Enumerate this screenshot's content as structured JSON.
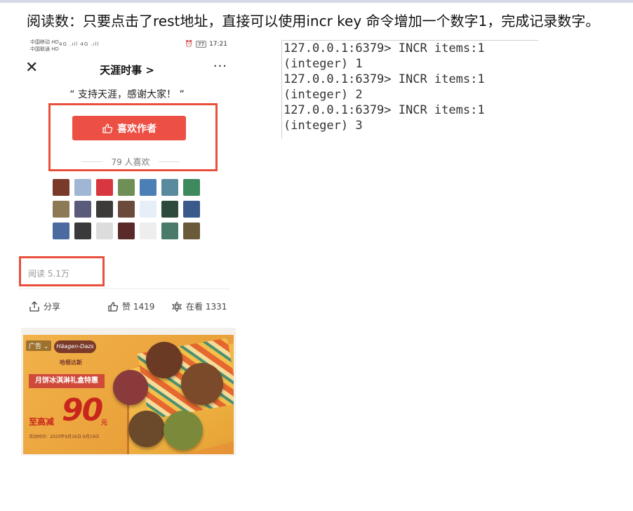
{
  "caption": "阅读数：只要点击了rest地址，直接可以使用incr key 命令增加一个数字1，完成记录数字。",
  "phone": {
    "status": {
      "carrier1": "中国移动 HD",
      "carrier2": "中国联通 HD",
      "signal": "4G .ıll 4G .ıll",
      "battery": "77",
      "time": "17:21"
    },
    "nav": {
      "close": "✕",
      "title": "天涯时事 >",
      "more": "···"
    },
    "quote": "“ 支持天涯，感谢大家！ ”",
    "like_button": "喜欢作者",
    "like_count": "79 人喜欢",
    "reads": "阅读 5.1万",
    "actions": {
      "share": "分享",
      "like": "赞 1419",
      "watching": "在看 1331"
    },
    "avatar_colors": [
      "#7a3a2a",
      "#9fb6d4",
      "#d8373f",
      "#6e8f56",
      "#4b7fb6",
      "#5a8a9e",
      "#3e8a5e",
      "#8c7a56",
      "#5a5a7a",
      "#3d3a3a",
      "#6a4a3a",
      "#e6eef8",
      "#2e4a3a",
      "#3a5a8a",
      "#4a6aa0",
      "#3a3a3a",
      "#dcdcdc",
      "#5a2a2a",
      "#eeeeee",
      "#4a7a6a",
      "#6a5a3a"
    ],
    "ad": {
      "tag": "广告 ⌄",
      "brand": "Häagen-Dazs",
      "sub": "哈根达斯",
      "banner": "月饼冰淇淋礼盒特惠",
      "prefix": "至高减",
      "amount": "90",
      "unit": "元",
      "time": "活动时间：2020年9月16日-9月19日"
    }
  },
  "terminal": {
    "lines": [
      "127.0.0.1:6379> INCR items:1",
      "(integer) 1",
      "127.0.0.1:6379> INCR items:1",
      "(integer) 2",
      "127.0.0.1:6379> INCR items:1",
      "(integer) 3"
    ]
  }
}
